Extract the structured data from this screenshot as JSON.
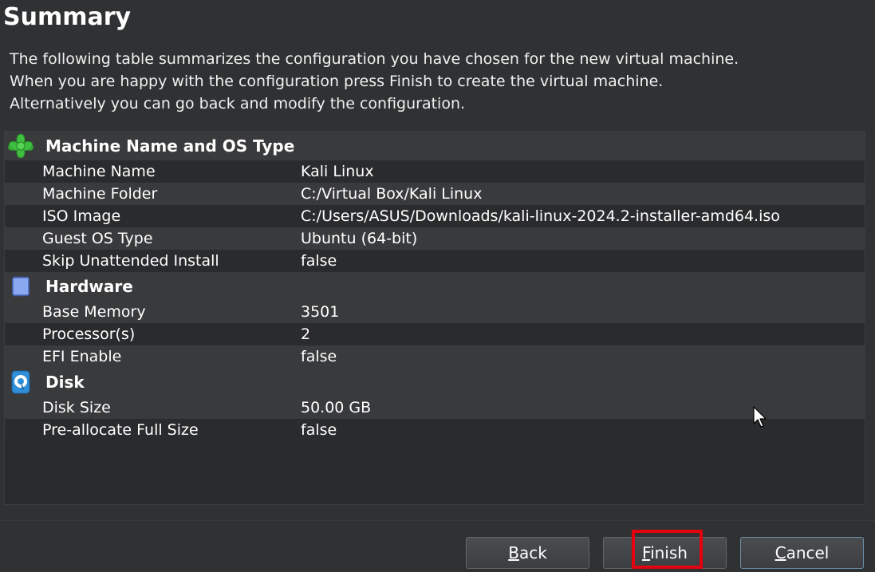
{
  "page": {
    "title": "Summary",
    "description": [
      "The following table summarizes the configuration you have chosen for the new virtual machine.",
      "When you are happy with the configuration press Finish to create the virtual machine.",
      "Alternatively you can go back and modify the configuration."
    ]
  },
  "sections": {
    "machine": {
      "label": "Machine Name and OS Type",
      "icon": "green-star-icon",
      "rows": [
        {
          "key": "Machine Name",
          "value": "Kali Linux"
        },
        {
          "key": "Machine Folder",
          "value": "C:/Virtual Box/Kali Linux"
        },
        {
          "key": "ISO Image",
          "value": "C:/Users/ASUS/Downloads/kali-linux-2024.2-installer-amd64.iso"
        },
        {
          "key": "Guest OS Type",
          "value": "Ubuntu (64-bit)"
        },
        {
          "key": "Skip Unattended Install",
          "value": "false"
        }
      ]
    },
    "hardware": {
      "label": "Hardware",
      "icon": "chip-icon",
      "rows": [
        {
          "key": "Base Memory",
          "value": "3501"
        },
        {
          "key": "Processor(s)",
          "value": "2"
        },
        {
          "key": "EFI Enable",
          "value": "false"
        }
      ]
    },
    "disk": {
      "label": "Disk",
      "icon": "disk-icon",
      "rows": [
        {
          "key": "Disk Size",
          "value": "50.00 GB"
        },
        {
          "key": "Pre-allocate Full Size",
          "value": "false"
        }
      ]
    }
  },
  "buttons": {
    "back": {
      "mnemonic": "B",
      "rest": "ack"
    },
    "finish": {
      "mnemonic": "F",
      "rest": "inish"
    },
    "cancel": {
      "mnemonic": "C",
      "rest": "ancel"
    }
  },
  "colors": {
    "background": "#2f3133",
    "highlight": "#e3000f",
    "star_green": "#3fbf3f",
    "chip_blue": "#8aa8f0",
    "disk_blue": "#2f8fd8"
  }
}
